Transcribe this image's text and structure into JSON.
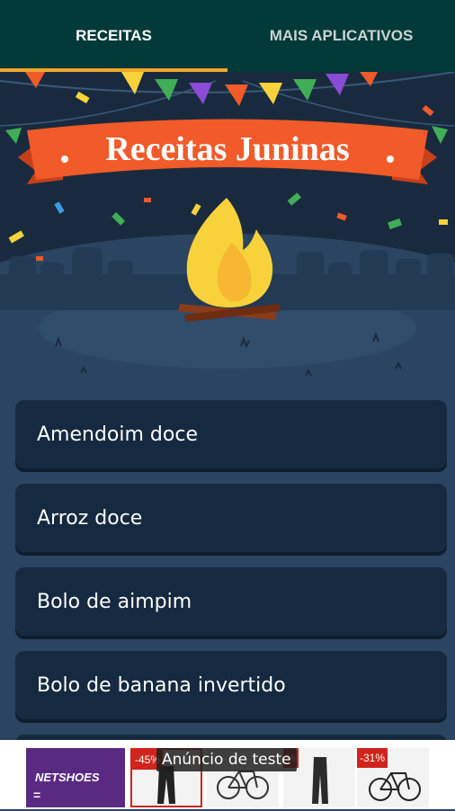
{
  "tabs": [
    {
      "label": "RECEITAS",
      "active": true
    },
    {
      "label": "MAIS APLICATIVOS",
      "active": false
    }
  ],
  "banner": {
    "title": "Receitas Juninas"
  },
  "recipes": [
    {
      "label": "Amendoim doce"
    },
    {
      "label": "Arroz doce"
    },
    {
      "label": "Bolo de aimpim"
    },
    {
      "label": "Bolo de banana invertido"
    }
  ],
  "ad": {
    "label": "Anúncio de teste",
    "brand": "NETSHOES",
    "menu_glyph": "=",
    "discounts": [
      "-45%",
      "%",
      "-31%"
    ]
  },
  "colors": {
    "tabbar": "#013a38",
    "indicator": "#f2a62b",
    "background": "#2a4461",
    "card": "#152a40",
    "ribbon": "#f15a29"
  }
}
